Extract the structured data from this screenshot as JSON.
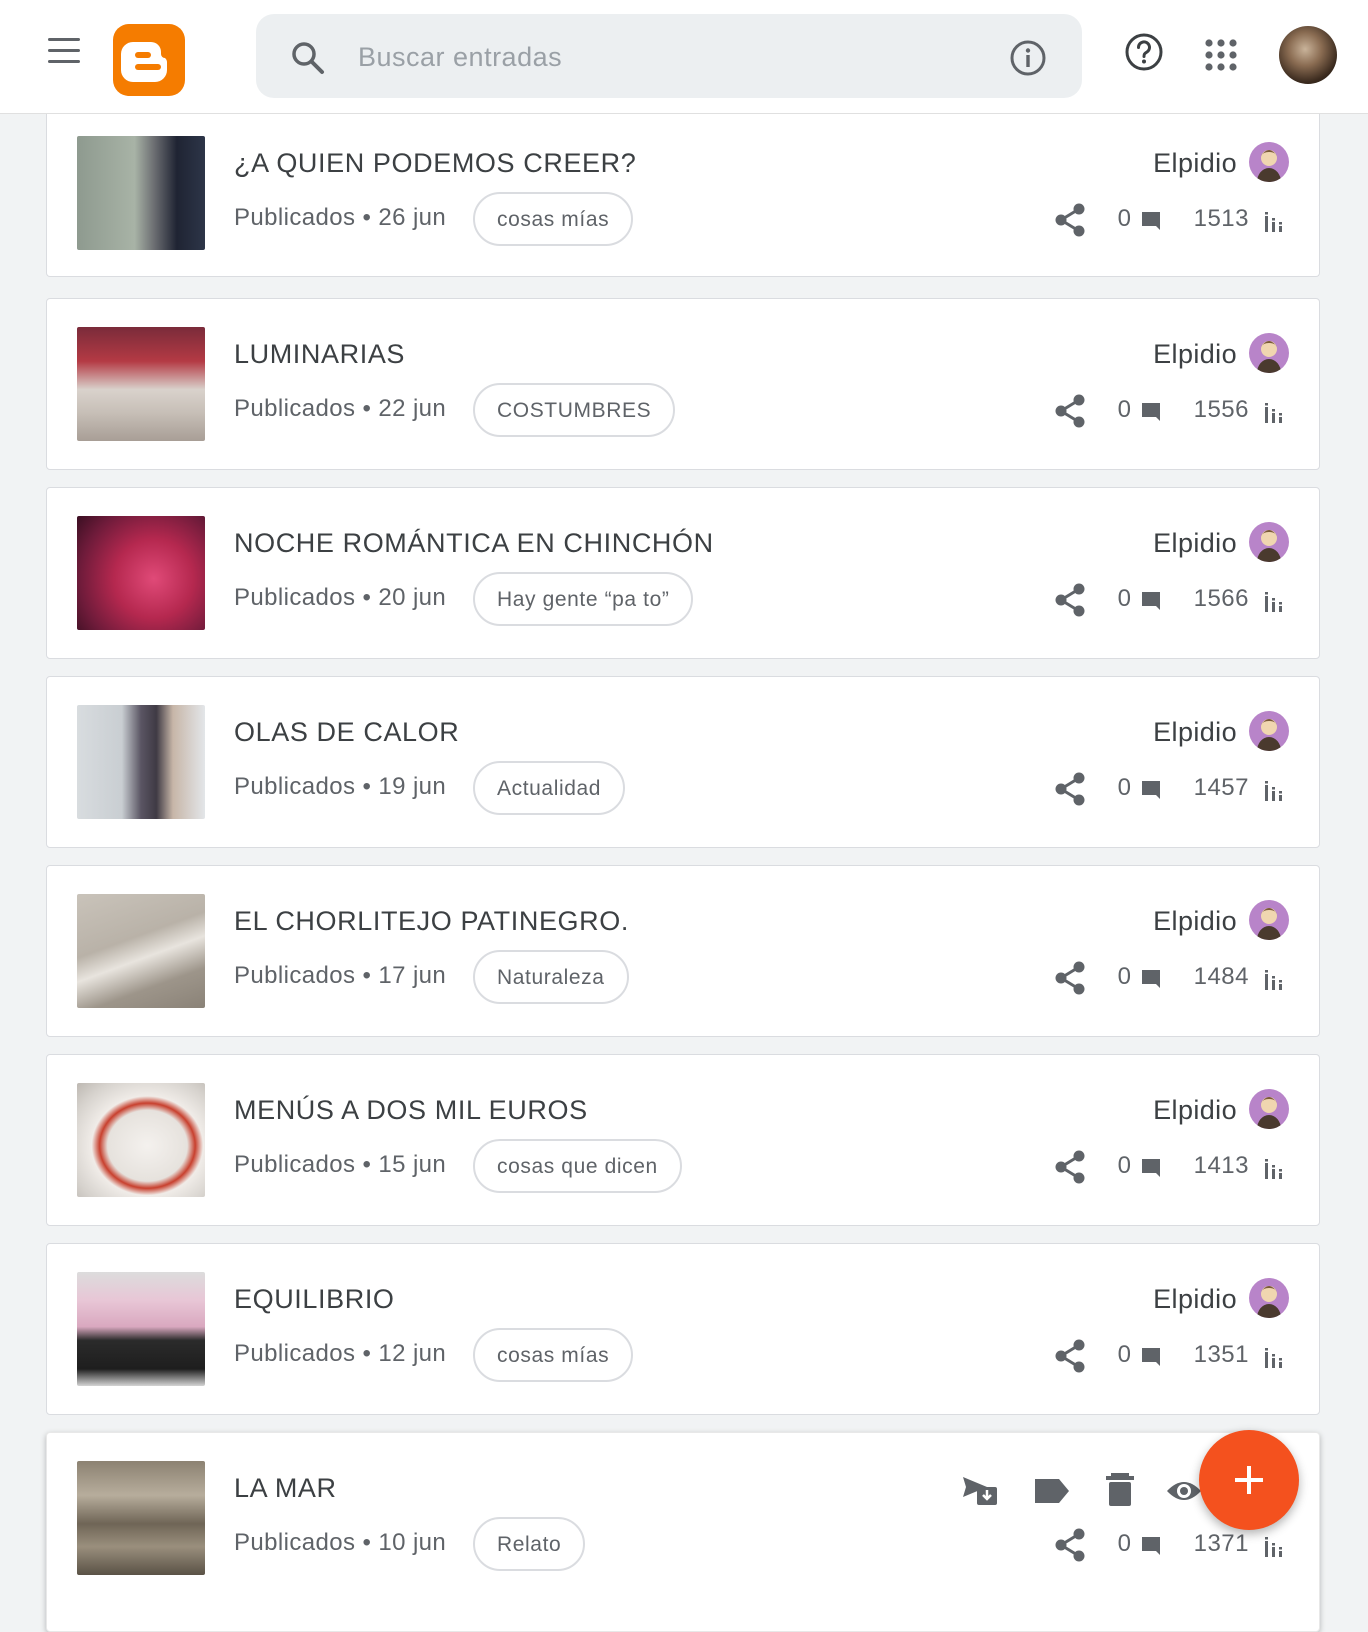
{
  "header": {
    "search_placeholder": "Buscar entradas",
    "brand_color": "#f57c00"
  },
  "posts": [
    {
      "title": "¿A QUIEN PODEMOS CREER?",
      "status": "Publicados",
      "date": "26 jun",
      "label": "cosas mías",
      "author": "Elpidio",
      "comments": "0",
      "views": "1513"
    },
    {
      "title": "LUMINARIAS",
      "status": "Publicados",
      "date": "22 jun",
      "label": "COSTUMBRES",
      "author": "Elpidio",
      "comments": "0",
      "views": "1556"
    },
    {
      "title": "NOCHE ROMÁNTICA EN CHINCHÓN",
      "status": "Publicados",
      "date": "20 jun",
      "label": "Hay gente “pa to”",
      "author": "Elpidio",
      "comments": "0",
      "views": "1566"
    },
    {
      "title": "OLAS DE CALOR",
      "status": "Publicados",
      "date": "19 jun",
      "label": "Actualidad",
      "author": "Elpidio",
      "comments": "0",
      "views": "1457"
    },
    {
      "title": "EL CHORLITEJO PATINEGRO.",
      "status": "Publicados",
      "date": "17 jun",
      "label": "Naturaleza",
      "author": "Elpidio",
      "comments": "0",
      "views": "1484"
    },
    {
      "title": "MENÚS A DOS MIL EUROS",
      "status": "Publicados",
      "date": "15 jun",
      "label": "cosas que dicen",
      "author": "Elpidio",
      "comments": "0",
      "views": "1413"
    },
    {
      "title": "EQUILIBRIO",
      "status": "Publicados",
      "date": "12 jun",
      "label": "cosas mías",
      "author": "Elpidio",
      "comments": "0",
      "views": "1351"
    },
    {
      "title": "LA MAR",
      "status": "Publicados",
      "date": "10 jun",
      "label": "Relato",
      "author": "",
      "comments": "0",
      "views": "1371"
    }
  ],
  "separator": "•",
  "fab_icon": "plus-icon",
  "fab_color": "#f4511e"
}
